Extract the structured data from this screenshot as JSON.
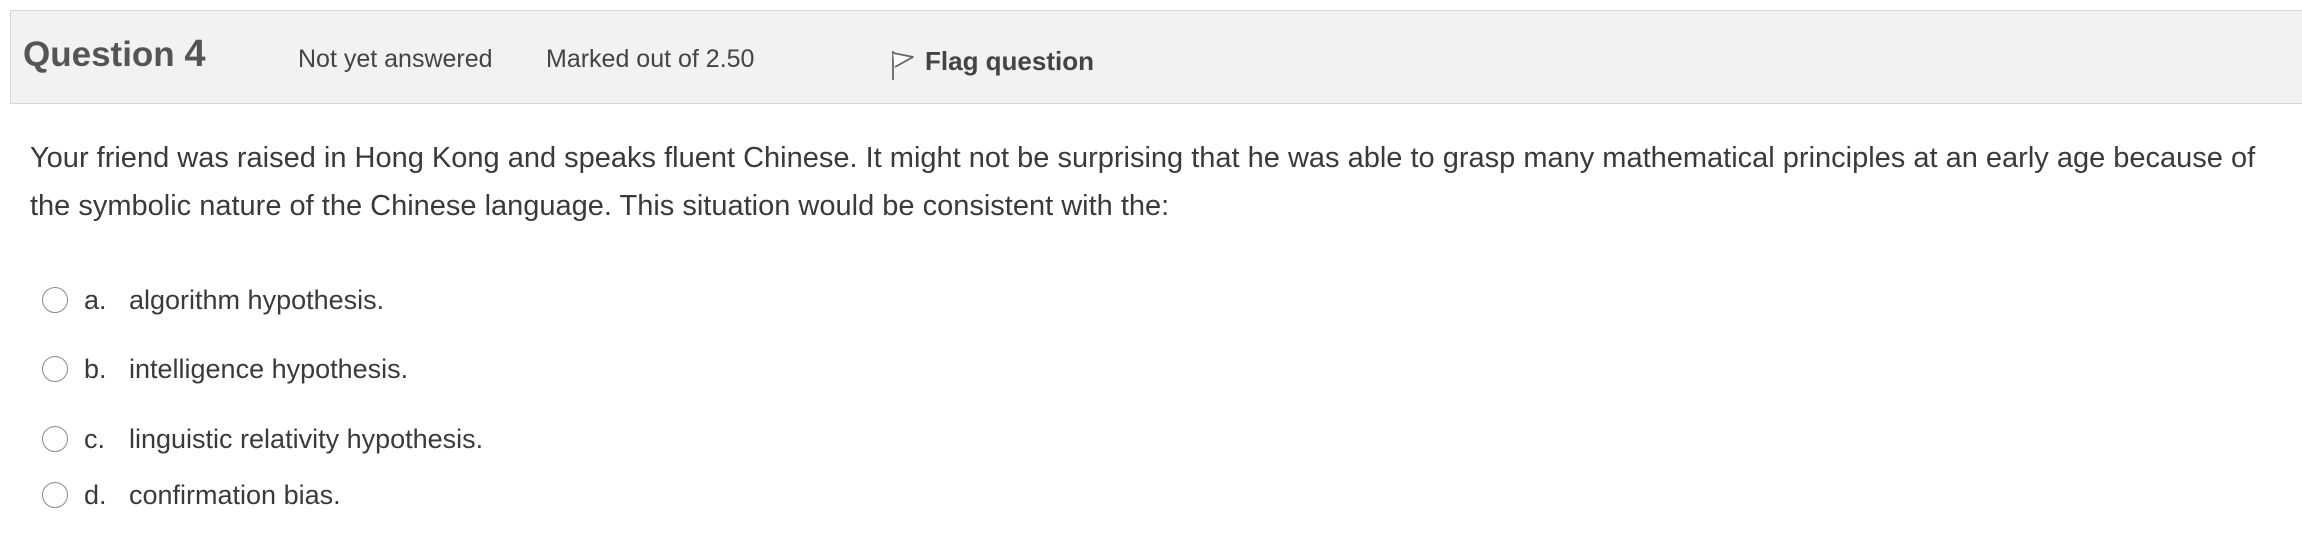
{
  "question": {
    "title_prefix": "Question",
    "number": "4",
    "state": "Not yet answered",
    "grade": "Marked out of 2.50",
    "flag_label": "Flag question",
    "text": "Your friend was raised in Hong Kong and speaks fluent Chinese. It might not be surprising that he was able to grasp many mathematical principles at an early age because of the symbolic nature of the Chinese language. This situation would be consistent with the:"
  },
  "answers": [
    {
      "letter": "a.",
      "text": "algorithm hypothesis."
    },
    {
      "letter": "b.",
      "text": "intelligence hypothesis."
    },
    {
      "letter": "c.",
      "text": "linguistic relativity hypothesis."
    },
    {
      "letter": "d.",
      "text": "confirmation bias."
    }
  ],
  "icons": {
    "flag": "flag-outline-icon",
    "radio": "radio-unselected-icon"
  }
}
